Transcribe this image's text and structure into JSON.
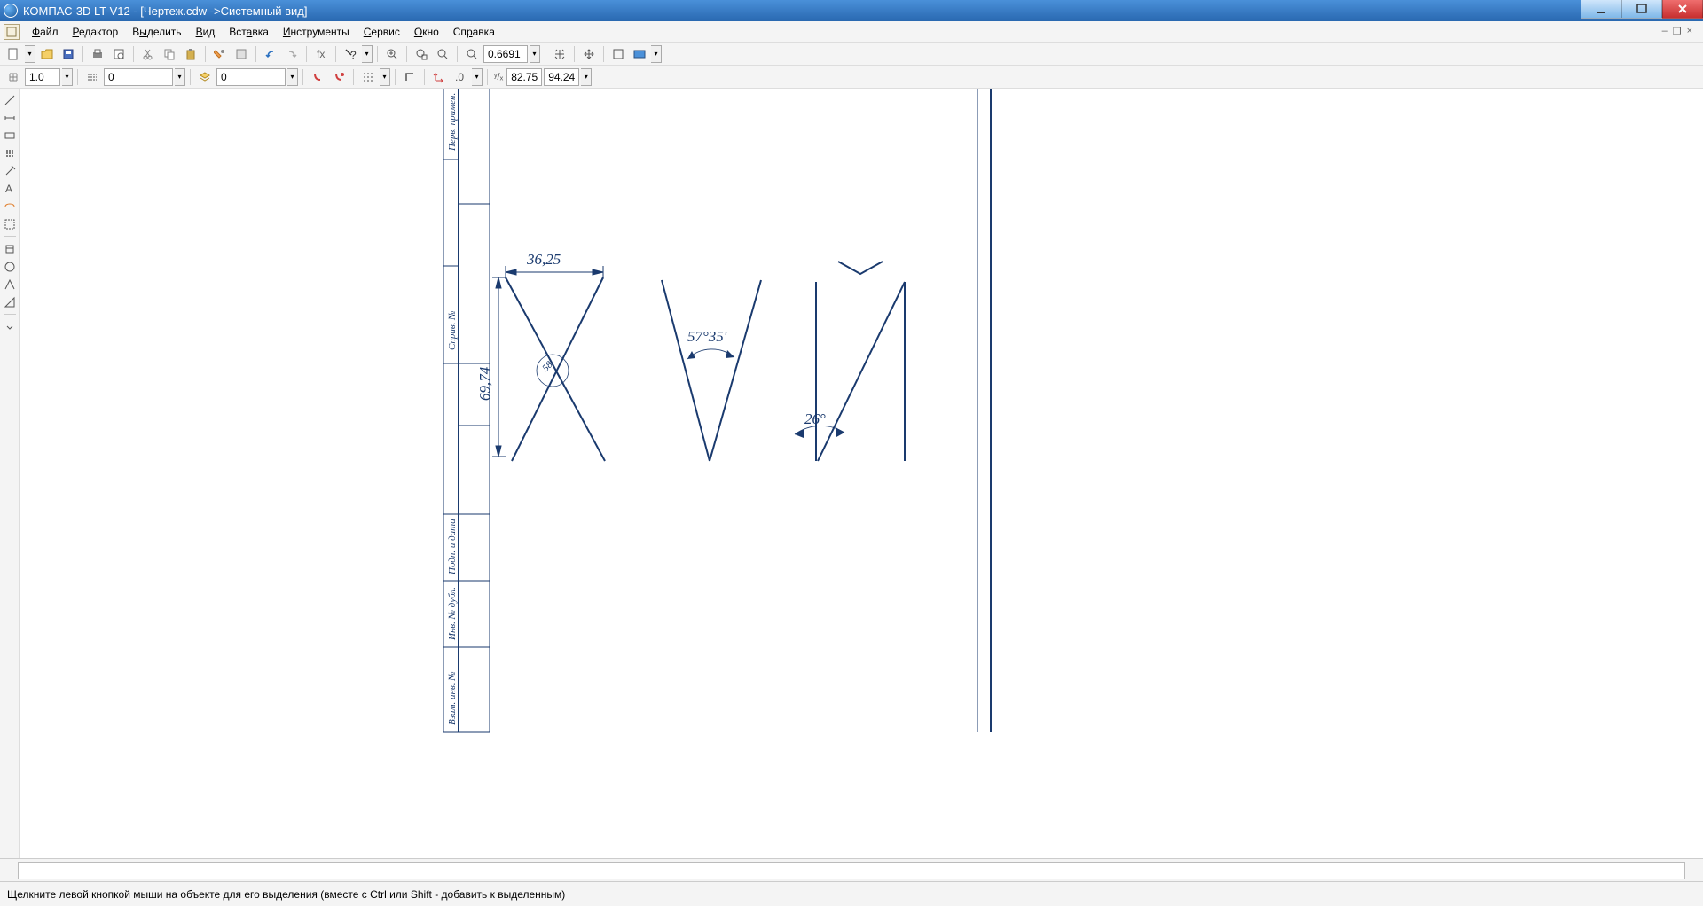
{
  "title": "КОМПАС-3D LT V12 - [Чертеж.cdw ->Системный вид]",
  "menu": {
    "file": "Файл",
    "editor": "Редактор",
    "select": "Выделить",
    "view": "Вид",
    "insert": "Вставка",
    "tools": "Инструменты",
    "service": "Сервис",
    "window": "Окно",
    "help": "Справка"
  },
  "toolbar1": {
    "zoom_value": "0.6691"
  },
  "toolbar2": {
    "step": "1.0",
    "style1": "0",
    "style2": "0",
    "coord_x_label": "x",
    "coord_x": "82.75",
    "coord_y": "94.24"
  },
  "drawing": {
    "dim_horizontal": "36,25",
    "dim_vertical": "69,74",
    "angle1": "57°35'",
    "angle2": "26°",
    "frame_labels": {
      "perv_primen": "Перв. примен.",
      "sprav": "Справ. №",
      "podp_data": "Подп. и дата",
      "inv_dubl": "Инв. № дубл.",
      "vzam_inv": "Взам. инв. №"
    }
  },
  "status": "Щелкните левой кнопкой мыши на объекте для его выделения (вместе с Ctrl или Shift - добавить к выделенным)"
}
